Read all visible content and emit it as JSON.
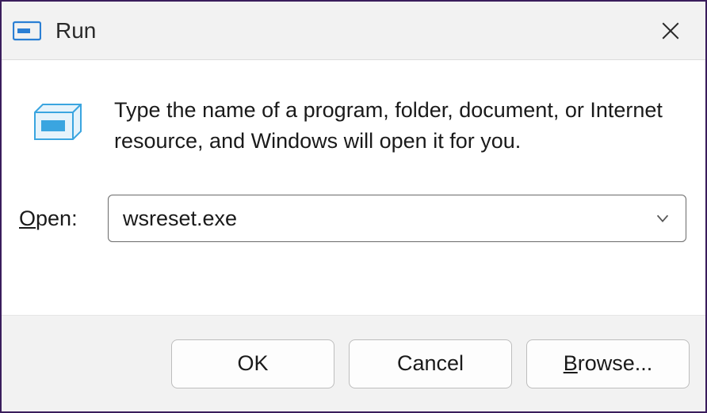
{
  "title": "Run",
  "description": "Type the name of a program, folder, document, or Internet resource, and Windows will open it for you.",
  "open_label_prefix": "O",
  "open_label_rest": "pen:",
  "combo_value": "wsreset.exe",
  "buttons": {
    "ok": "OK",
    "cancel": "Cancel",
    "browse_prefix": "B",
    "browse_rest": "rowse..."
  }
}
